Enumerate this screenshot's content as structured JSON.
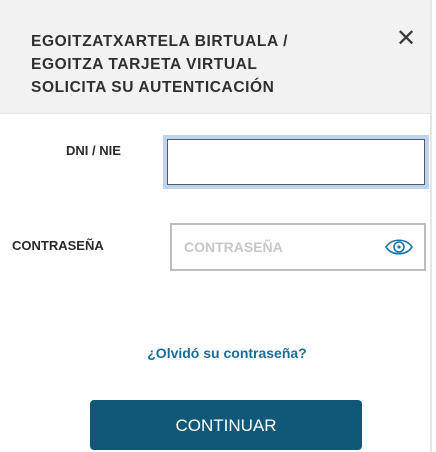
{
  "header": {
    "title_lines": [
      "EGOITZATXARTELA BIRTUALA /",
      "EGOITZA TARJETA VIRTUAL",
      "SOLICITA SU AUTENTICACIÓN"
    ],
    "close_label": "✕",
    "background": "#f2f2f2"
  },
  "form": {
    "dni_label": "DNI / NIE",
    "dni_value": "",
    "password_label": "CONTRASEÑA",
    "password_placeholder": "CONTRASEÑA",
    "password_value": "",
    "toggle_icon": "eye-icon"
  },
  "links": {
    "forgot_password": "¿Olvidó su contraseña?",
    "link_color": "#1a6d99"
  },
  "actions": {
    "continue_label": "CONTINUAR",
    "button_color": "#0f5878"
  }
}
